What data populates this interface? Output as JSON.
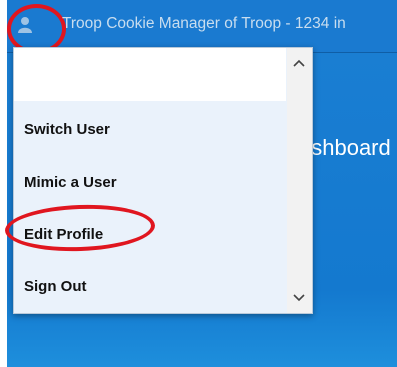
{
  "header": {
    "title": "Troop Cookie Manager of Troop - 1234 in"
  },
  "main": {
    "dashboard_fragment": "ashboard"
  },
  "user_menu": {
    "items": [
      {
        "label": "Switch User"
      },
      {
        "label": "Mimic a User"
      },
      {
        "label": "Edit Profile"
      },
      {
        "label": "Sign Out"
      }
    ]
  },
  "colors": {
    "app_blue": "#1a7ad0",
    "menu_bg": "#eaf2fb",
    "highlight_ring": "#e0161f"
  },
  "icons": {
    "avatar": "user-icon",
    "scroll_up": "chevron-up-icon",
    "scroll_down": "chevron-down-icon"
  }
}
